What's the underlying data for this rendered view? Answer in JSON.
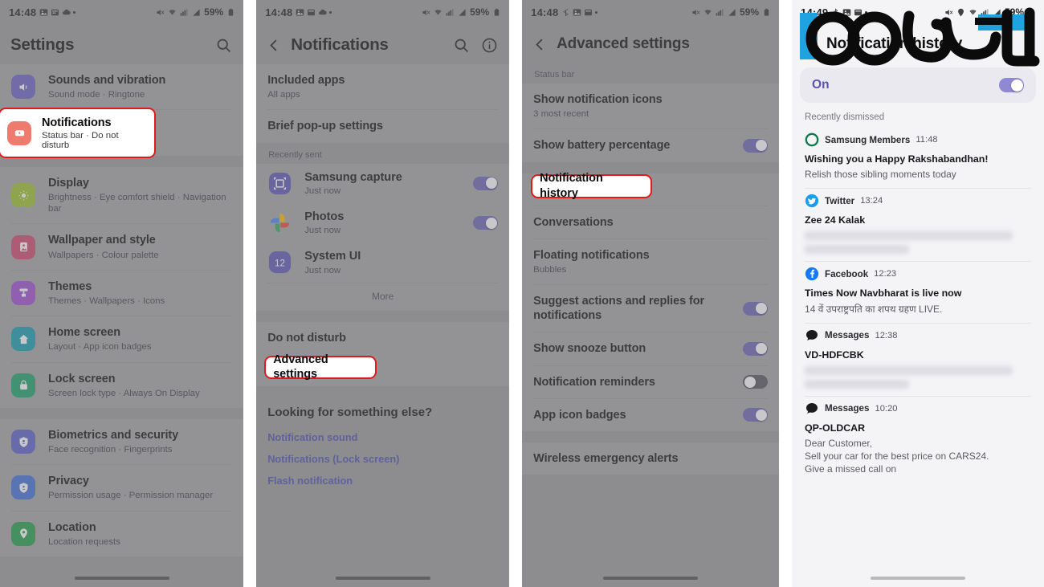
{
  "panel1": {
    "status": {
      "time": "14:48",
      "battery": "59%"
    },
    "title": "Settings",
    "search_icon": "search-icon",
    "items": [
      {
        "title": "Sounds and vibration",
        "subtitle": "Sound mode  ·  Ringtone",
        "color": "#6a61c4",
        "icon": "speaker-icon"
      },
      {
        "title": "Notifications",
        "subtitle": "Status bar  ·  Do not disturb",
        "color": "#ef7b6e",
        "icon": "notification-icon",
        "highlighted": true
      },
      {
        "title": "Display",
        "subtitle": "Brightness  ·  Eye comfort shield  ·  Navigation bar",
        "color": "#9dc22a",
        "icon": "brightness-icon"
      },
      {
        "title": "Wallpaper and style",
        "subtitle": "Wallpapers  ·  Colour palette",
        "color": "#d0456e",
        "icon": "wallpaper-icon"
      },
      {
        "title": "Themes",
        "subtitle": "Themes  ·  Wallpapers  ·  Icons",
        "color": "#a04ad0",
        "icon": "themes-icon"
      },
      {
        "title": "Home screen",
        "subtitle": "Layout  ·  App icon badges",
        "color": "#129cae",
        "icon": "home-icon"
      },
      {
        "title": "Lock screen",
        "subtitle": "Screen lock type  ·  Always On Display",
        "color": "#1ba06a",
        "icon": "lock-icon"
      },
      {
        "title": "Biometrics and security",
        "subtitle": "Face recognition  ·  Fingerprints",
        "color": "#5a5fc8",
        "icon": "shield-icon"
      },
      {
        "title": "Privacy",
        "subtitle": "Permission usage  ·  Permission manager",
        "color": "#3f6fd6",
        "icon": "privacy-icon"
      },
      {
        "title": "Location",
        "subtitle": "Location requests",
        "color": "#1f9e45",
        "icon": "location-pin-icon"
      }
    ]
  },
  "panel2": {
    "status": {
      "time": "14:48",
      "battery": "59%"
    },
    "title": "Notifications",
    "actions": [
      "search-icon",
      "info-icon"
    ],
    "rows": [
      {
        "title": "Included apps",
        "subtitle": "All apps"
      },
      {
        "title": "Brief pop-up settings",
        "subtitle": ""
      }
    ],
    "recent_label": "Recently sent",
    "apps": [
      {
        "name": "Samsung capture",
        "time": "Just now",
        "toggle": "on",
        "color": "#5d55b5",
        "icon": "capture-icon"
      },
      {
        "name": "Photos",
        "time": "Just now",
        "toggle": "on",
        "color": "#ffffff",
        "icon": "google-photos-icon"
      },
      {
        "name": "System UI",
        "time": "Just now",
        "toggle": "none",
        "color": "#5d55b5",
        "icon": "system-ui-icon"
      }
    ],
    "more_label": "More",
    "dnd_label": "Do not disturb",
    "advanced_label": "Advanced settings",
    "looking_header": "Looking for something else?",
    "links": [
      "Notification sound",
      "Notifications (Lock screen)",
      "Flash notification"
    ]
  },
  "panel3": {
    "status": {
      "time": "14:48",
      "battery": "59%"
    },
    "title": "Advanced settings",
    "section_label": "Status bar",
    "rows": [
      {
        "title": "Show notification icons",
        "subtitle": "3 most recent",
        "toggle": "none"
      },
      {
        "title": "Show battery percentage",
        "subtitle": "",
        "toggle": "on"
      },
      {
        "title": "Notification history",
        "subtitle": "",
        "toggle": "none",
        "highlighted": true
      },
      {
        "title": "Conversations",
        "subtitle": "",
        "toggle": "none"
      },
      {
        "title": "Floating notifications",
        "subtitle": "Bubbles",
        "toggle": "none"
      },
      {
        "title": "Suggest actions and replies for notifications",
        "subtitle": "",
        "toggle": "on"
      },
      {
        "title": "Show snooze button",
        "subtitle": "",
        "toggle": "on"
      },
      {
        "title": "Notification reminders",
        "subtitle": "",
        "toggle": "off"
      },
      {
        "title": "App icon badges",
        "subtitle": "",
        "toggle": "on"
      }
    ],
    "last_row": "Wireless emergency alerts"
  },
  "panel4": {
    "status": {
      "time": "14:49",
      "battery": "59%"
    },
    "title": "Notification history",
    "on_label": "On",
    "on_toggle": "on",
    "recent_label": "Recently dismissed",
    "watermark": "اقتصاد 100",
    "notifications": [
      {
        "app": "Samsung Members",
        "time": "11:48",
        "title": "Wishing you a Happy Rakshabandhan!",
        "body": "Relish those sibling moments today",
        "icon": "samsung-members-icon",
        "blurred": false
      },
      {
        "app": "Twitter",
        "time": "13:24",
        "title": "Zee 24 Kalak",
        "body": "",
        "icon": "twitter-icon",
        "blurred": true
      },
      {
        "app": "Facebook",
        "time": "12:23",
        "title": "Times Now Navbharat is live now",
        "body": "14 वें उपराष्ट्रपति का शपथ ग्रहण LIVE.",
        "icon": "facebook-icon",
        "blurred": false
      },
      {
        "app": "Messages",
        "time": "12:38",
        "title": "VD-HDFCBK",
        "body": "",
        "icon": "messages-icon",
        "blurred": true
      },
      {
        "app": "Messages",
        "time": "10:20",
        "title": "QP-OLDCAR",
        "body": "Dear Customer,\nSell your car for the best price on CARS24.\nGive a missed call on",
        "icon": "messages-icon",
        "blurred": false
      }
    ]
  },
  "colors": {
    "accent": "#6b62b5",
    "highlight": "#e01a1a",
    "link": "#4a4fb0"
  }
}
